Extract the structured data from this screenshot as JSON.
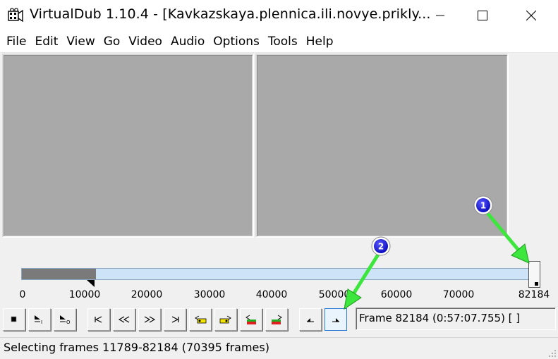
{
  "window": {
    "title": "VirtualDub 1.10.4 - [Kavkazskaya.plennica.ili.novye.prikly...",
    "app_icon": "film-reel-icon",
    "controls": [
      "minimize-icon",
      "maximize-icon",
      "close-icon"
    ]
  },
  "menu": {
    "items": [
      {
        "label": "File"
      },
      {
        "label": "Edit"
      },
      {
        "label": "View"
      },
      {
        "label": "Go"
      },
      {
        "label": "Video"
      },
      {
        "label": "Audio"
      },
      {
        "label": "Options"
      },
      {
        "label": "Tools"
      },
      {
        "label": "Help"
      }
    ]
  },
  "timeline": {
    "total_frames": 82184,
    "selection_start": 11789,
    "selection_end": 82184,
    "current_frame": 82184,
    "tick_labels": [
      "0",
      "10000",
      "20000",
      "30000",
      "40000",
      "50000",
      "60000",
      "70000",
      "82184"
    ],
    "track_color": "#cde4f8",
    "unselected_color": "#7a7a7a"
  },
  "toolbar": {
    "buttons": [
      {
        "icon": "stop-icon"
      },
      {
        "icon": "play-input-icon"
      },
      {
        "icon": "play-output-icon"
      },
      {
        "icon": "go-to-start-icon"
      },
      {
        "icon": "step-back-icon"
      },
      {
        "icon": "step-forward-icon"
      },
      {
        "icon": "go-to-end-icon"
      },
      {
        "icon": "previous-keyframe-icon"
      },
      {
        "icon": "next-keyframe-icon"
      },
      {
        "icon": "previous-scene-icon"
      },
      {
        "icon": "next-scene-icon"
      },
      {
        "icon": "mark-in-icon"
      },
      {
        "icon": "mark-out-icon"
      }
    ],
    "active_button": "mark-out-icon",
    "frame_readout": "Frame 82184 (0:57:07.755) [ ]"
  },
  "status": {
    "text": "Selecting frames 11789-82184 (70395 frames)"
  },
  "annotations": {
    "badges": [
      {
        "label": "1",
        "color": "#1a1ad6"
      },
      {
        "label": "2",
        "color": "#1a1ad6"
      }
    ],
    "arrow_color": "#3ce63c"
  }
}
